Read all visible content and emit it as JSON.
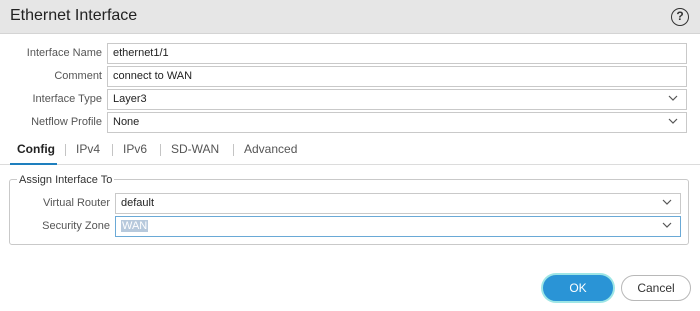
{
  "dialog": {
    "title": "Ethernet Interface",
    "help_icon": "question-circle-icon",
    "help_glyph": "?"
  },
  "fields": [
    {
      "label": "Interface Name",
      "value": "ethernet1/1"
    },
    {
      "label": "Comment",
      "value": "connect to WAN"
    },
    {
      "label": "Interface Type",
      "value": "Layer3"
    },
    {
      "label": "Netflow Profile",
      "value": "None"
    }
  ],
  "tabs": [
    {
      "label": "Config",
      "active": true
    },
    {
      "label": "IPv4"
    },
    {
      "label": "IPv6"
    },
    {
      "label": "SD-WAN"
    },
    {
      "label": "Advanced"
    }
  ],
  "assign": {
    "title": "Assign Interface To",
    "virtual_router": {
      "label": "Virtual Router",
      "value": "default"
    },
    "security_zone": {
      "label": "Security Zone",
      "value": "WAN"
    }
  },
  "buttons": {
    "ok": "OK",
    "cancel": "Cancel"
  },
  "colors": {
    "accent": "#2a94d6",
    "tab_underline": "#1e7fbe"
  }
}
